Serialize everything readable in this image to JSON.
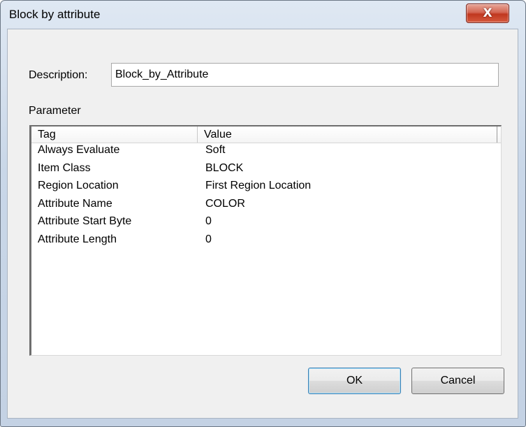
{
  "window": {
    "title": "Block by attribute",
    "close_label": "X"
  },
  "description": {
    "label": "Description:",
    "value": "Block_by_Attribute"
  },
  "parameter": {
    "label": "Parameter",
    "columns": [
      "Tag",
      "Value"
    ],
    "rows": [
      {
        "tag": "Always Evaluate",
        "value": "Soft"
      },
      {
        "tag": "Item Class",
        "value": "BLOCK"
      },
      {
        "tag": "Region Location",
        "value": "First Region Location"
      },
      {
        "tag": "Attribute Name",
        "value": "COLOR"
      },
      {
        "tag": "Attribute Start Byte",
        "value": "0"
      },
      {
        "tag": "Attribute Length",
        "value": "0"
      }
    ]
  },
  "buttons": {
    "ok": "OK",
    "cancel": "Cancel"
  }
}
